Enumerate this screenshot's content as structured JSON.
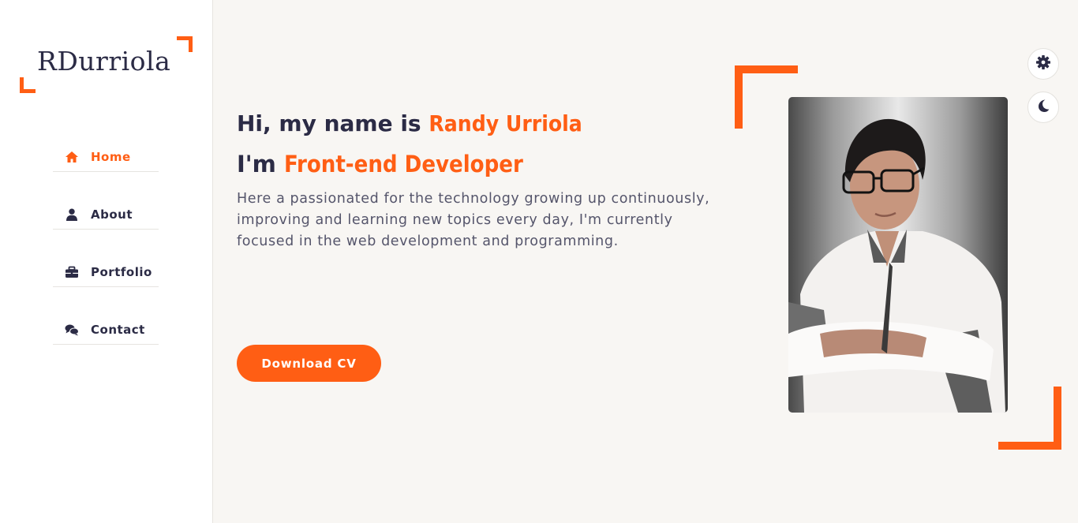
{
  "colors": {
    "accent": "#ff5e14",
    "dark": "#2b2b45",
    "background": "#f8f6f3",
    "sidebar": "#ffffff"
  },
  "logo": {
    "text": "RDurriola"
  },
  "nav": {
    "items": [
      {
        "label": "Home",
        "icon": "home-icon",
        "active": true
      },
      {
        "label": "About",
        "icon": "user-icon",
        "active": false
      },
      {
        "label": "Portfolio",
        "icon": "briefcase-icon",
        "active": false
      },
      {
        "label": "Contact",
        "icon": "comments-icon",
        "active": false
      }
    ]
  },
  "hero": {
    "greeting": "Hi, my name is ",
    "name": "Randy Urriola",
    "role_prefix": "I'm ",
    "role": "Front-end Developer",
    "description": "Here a passionated for the technology growing up continuously, improving and learning new topics every day, I'm currently focused in the web development and programming.",
    "cv_button": "Download CV"
  },
  "controls": {
    "settings_icon": "gear-icon",
    "theme_icon": "moon-icon"
  }
}
